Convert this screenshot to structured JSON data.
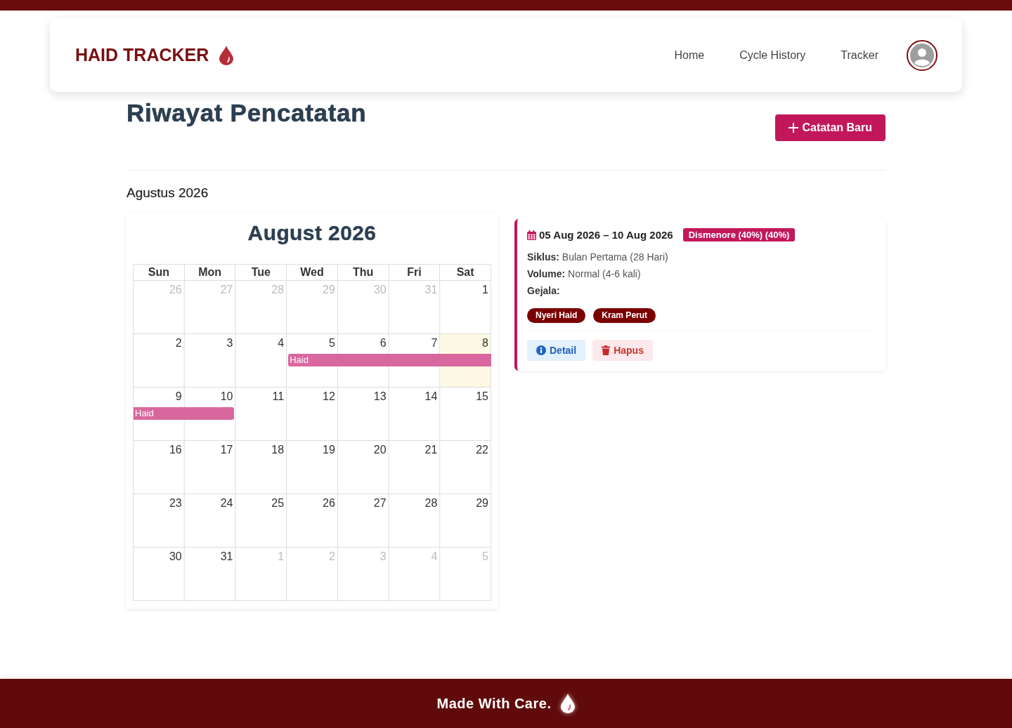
{
  "navbar": {
    "brand": "HAID TRACKER",
    "links": [
      "Home",
      "Cycle History",
      "Tracker"
    ]
  },
  "page": {
    "title": "Riwayat Pencatatan",
    "new_button": "Catatan Baru"
  },
  "month_heading": "Agustus 2026",
  "calendar": {
    "title": "August 2026",
    "weekdays": [
      "Sun",
      "Mon",
      "Tue",
      "Wed",
      "Thu",
      "Fri",
      "Sat"
    ],
    "weeks": [
      [
        {
          "day": "26",
          "outside": true,
          "today": false,
          "period": false
        },
        {
          "day": "27",
          "outside": true,
          "today": false,
          "period": false
        },
        {
          "day": "28",
          "outside": true,
          "today": false,
          "period": false
        },
        {
          "day": "29",
          "outside": true,
          "today": false,
          "period": false
        },
        {
          "day": "30",
          "outside": true,
          "today": false,
          "period": false
        },
        {
          "day": "31",
          "outside": true,
          "today": false,
          "period": false
        },
        {
          "day": "1",
          "outside": false,
          "today": false,
          "period": false
        }
      ],
      [
        {
          "day": "2",
          "outside": false,
          "today": false,
          "period": false
        },
        {
          "day": "3",
          "outside": false,
          "today": false,
          "period": false
        },
        {
          "day": "4",
          "outside": false,
          "today": false,
          "period": false
        },
        {
          "day": "5",
          "outside": false,
          "today": false,
          "period": true,
          "event_label": "Haid"
        },
        {
          "day": "6",
          "outside": false,
          "today": false,
          "period": true
        },
        {
          "day": "7",
          "outside": false,
          "today": false,
          "period": true
        },
        {
          "day": "8",
          "outside": false,
          "today": true,
          "period": true
        }
      ],
      [
        {
          "day": "9",
          "outside": false,
          "today": false,
          "period": true,
          "event_label": "Haid"
        },
        {
          "day": "10",
          "outside": false,
          "today": false,
          "period": true
        },
        {
          "day": "11",
          "outside": false,
          "today": false,
          "period": false
        },
        {
          "day": "12",
          "outside": false,
          "today": false,
          "period": false
        },
        {
          "day": "13",
          "outside": false,
          "today": false,
          "period": false
        },
        {
          "day": "14",
          "outside": false,
          "today": false,
          "period": false
        },
        {
          "day": "15",
          "outside": false,
          "today": false,
          "period": false
        }
      ],
      [
        {
          "day": "16",
          "outside": false,
          "today": false,
          "period": false
        },
        {
          "day": "17",
          "outside": false,
          "today": false,
          "period": false
        },
        {
          "day": "18",
          "outside": false,
          "today": false,
          "period": false
        },
        {
          "day": "19",
          "outside": false,
          "today": false,
          "period": false
        },
        {
          "day": "20",
          "outside": false,
          "today": false,
          "period": false
        },
        {
          "day": "21",
          "outside": false,
          "today": false,
          "period": false
        },
        {
          "day": "22",
          "outside": false,
          "today": false,
          "period": false
        }
      ],
      [
        {
          "day": "23",
          "outside": false,
          "today": false,
          "period": false
        },
        {
          "day": "24",
          "outside": false,
          "today": false,
          "period": false
        },
        {
          "day": "25",
          "outside": false,
          "today": false,
          "period": false
        },
        {
          "day": "26",
          "outside": false,
          "today": false,
          "period": false
        },
        {
          "day": "27",
          "outside": false,
          "today": false,
          "period": false
        },
        {
          "day": "28",
          "outside": false,
          "today": false,
          "period": false
        },
        {
          "day": "29",
          "outside": false,
          "today": false,
          "period": false
        }
      ],
      [
        {
          "day": "30",
          "outside": false,
          "today": false,
          "period": false
        },
        {
          "day": "31",
          "outside": false,
          "today": false,
          "period": false
        },
        {
          "day": "1",
          "outside": true,
          "today": false,
          "period": false
        },
        {
          "day": "2",
          "outside": true,
          "today": false,
          "period": false
        },
        {
          "day": "3",
          "outside": true,
          "today": false,
          "period": false
        },
        {
          "day": "4",
          "outside": true,
          "today": false,
          "period": false
        },
        {
          "day": "5",
          "outside": true,
          "today": false,
          "period": false
        }
      ]
    ]
  },
  "record": {
    "date_range": "05 Aug 2026 – 10 Aug 2026",
    "badge": "Dismenore (40%) (40%)",
    "lines": [
      "**Siklus:** Bulan Pertama (28 Hari)",
      "**Volume:** Normal (4-6 kali)"
    ],
    "symptoms_label": "Gejala:",
    "symptoms": [
      "Nyeri Haid",
      "Kram Perut"
    ],
    "actions": [
      {
        "kind": "detail",
        "label": "Detail"
      },
      {
        "kind": "delete",
        "label": "Hapus"
      }
    ]
  },
  "footer": {
    "text": "Made With Care."
  }
}
